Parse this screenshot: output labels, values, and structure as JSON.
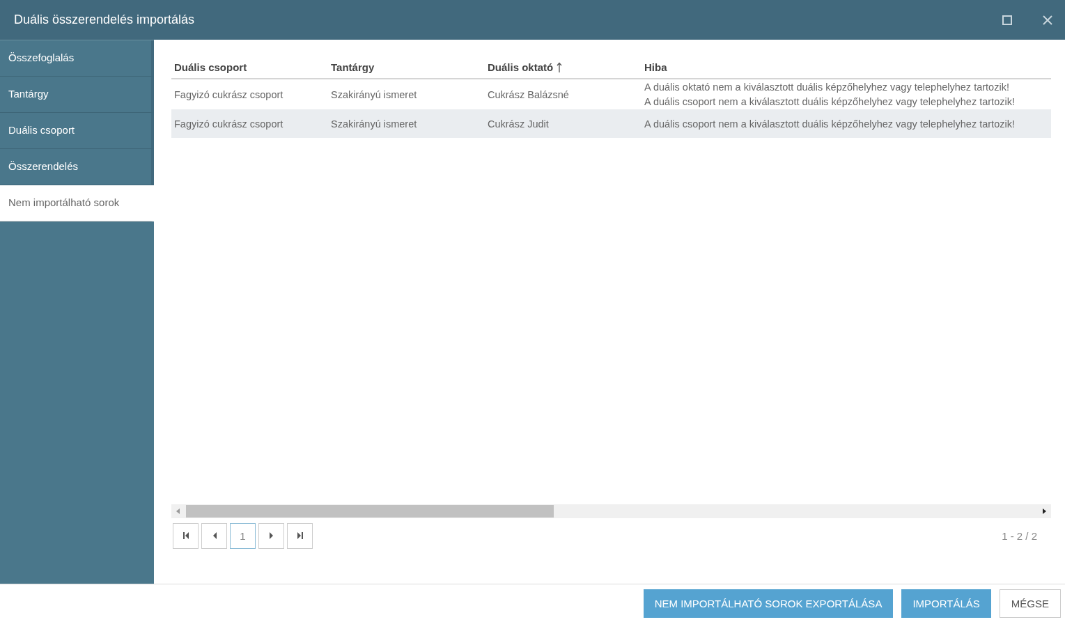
{
  "window": {
    "title": "Duális összerendelés importálás"
  },
  "sidebar": {
    "items": [
      {
        "label": "Összefoglalás",
        "selected": false
      },
      {
        "label": "Tantárgy",
        "selected": false
      },
      {
        "label": "Duális csoport",
        "selected": false
      },
      {
        "label": "Összerendelés",
        "selected": false
      },
      {
        "label": "Nem importálható sorok",
        "selected": true
      }
    ]
  },
  "table": {
    "columns": [
      {
        "label": "Duális csoport",
        "sorted": false
      },
      {
        "label": "Tantárgy",
        "sorted": false
      },
      {
        "label": "Duális oktató",
        "sorted": true
      },
      {
        "label": "Hiba",
        "sorted": false
      }
    ],
    "rows": [
      {
        "cells": [
          "Fagyizó cukrász csoport",
          "Szakirányú ismeret",
          "Cukrász Balázsné"
        ],
        "errors": [
          "A duális oktató nem a kiválasztott duális képzőhelyhez vagy telephelyhez tartozik!",
          "A duális csoport nem a kiválasztott duális képzőhelyhez vagy telephelyhez tartozik!"
        ],
        "selected": false
      },
      {
        "cells": [
          "Fagyizó cukrász csoport",
          "Szakirányú ismeret",
          "Cukrász Judit"
        ],
        "errors": [
          "A duális csoport nem a kiválasztott duális képzőhelyhez vagy telephelyhez tartozik!"
        ],
        "selected": true
      }
    ]
  },
  "pager": {
    "pages": [
      {
        "label": "1",
        "selected": true
      }
    ],
    "summary": "1 - 2 / 2"
  },
  "buttons": [
    {
      "label": "NEM IMPORTÁLHATÓ SOROK EXPORTÁLÁSA",
      "kind": "primary"
    },
    {
      "label": "IMPORTÁLÁS",
      "kind": "primary"
    },
    {
      "label": "MÉGSE",
      "kind": "secondary"
    }
  ]
}
